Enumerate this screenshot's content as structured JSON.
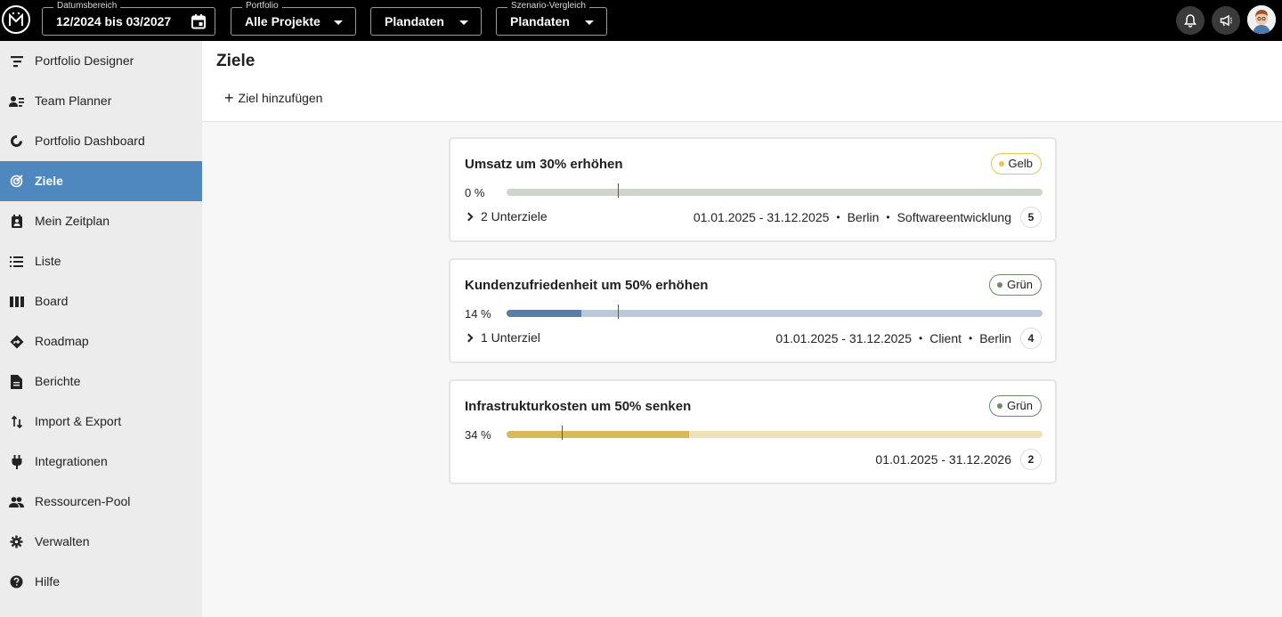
{
  "topbar": {
    "logo": "M",
    "date_range": {
      "label": "Datumsbereich",
      "value": "12/2024 bis 03/2027",
      "icon": "calendar-icon"
    },
    "portfolio": {
      "label": "Portfolio",
      "value": "Alle Projekte"
    },
    "data_select": {
      "value": "Plandaten"
    },
    "scenario": {
      "label": "Szenario-Vergleich",
      "value": "Plandaten"
    },
    "icons": [
      "bell-icon",
      "megaphone-icon",
      "avatar"
    ]
  },
  "sidebar": {
    "items": [
      {
        "label": "Portfolio Designer",
        "icon": "portfolio-designer-icon"
      },
      {
        "label": "Team Planner",
        "icon": "team-planner-icon"
      },
      {
        "label": "Portfolio Dashboard",
        "icon": "dashboard-icon"
      },
      {
        "label": "Ziele",
        "icon": "target-icon",
        "active": true
      },
      {
        "label": "Mein Zeitplan",
        "icon": "schedule-icon"
      },
      {
        "label": "Liste",
        "icon": "list-icon"
      },
      {
        "label": "Board",
        "icon": "board-icon"
      },
      {
        "label": "Roadmap",
        "icon": "roadmap-icon"
      },
      {
        "label": "Berichte",
        "icon": "report-icon"
      },
      {
        "label": "Import & Export",
        "icon": "import-export-icon"
      },
      {
        "label": "Integrationen",
        "icon": "plug-icon"
      },
      {
        "label": "Ressourcen-Pool",
        "icon": "people-icon"
      },
      {
        "label": "Verwalten",
        "icon": "gear-icon"
      },
      {
        "label": "Hilfe",
        "icon": "help-icon"
      }
    ],
    "active_color": "#4f87bf"
  },
  "main": {
    "title": "Ziele",
    "add_goal": "Ziel hinzufügen"
  },
  "goals": [
    {
      "title": "Umsatz um 30% erhöhen",
      "status": "Gelb",
      "status_color": "#e6c54a",
      "progress_label": "0 %",
      "progress": 0,
      "time_marker": 0.207,
      "bar_track_color": "#cfd6c9",
      "bar_fill_color": "#9aa894",
      "subgoals": "2 Unterziele",
      "date_range": "01.01.2025 - 31.12.2025",
      "tags": [
        "Berlin",
        "Softwareentwicklung"
      ],
      "count": "5"
    },
    {
      "title": "Kundenzufriedenheit um 50% erhöhen",
      "status": "Grün",
      "status_color": "#6f8a68",
      "progress_label": "14 %",
      "progress": 0.14,
      "time_marker": 0.207,
      "bar_track_color": "#bac8d8",
      "bar_fill_color": "#5b7ca3",
      "subgoals": "1 Unterziel",
      "date_range": "01.01.2025 - 31.12.2025",
      "tags": [
        "Client",
        "Berlin"
      ],
      "count": "4"
    },
    {
      "title": "Infrastrukturkosten um 50% senken",
      "status": "Grün",
      "status_color": "#6f8a68",
      "progress_label": "34 %",
      "progress": 0.34,
      "time_marker": 0.103,
      "bar_track_color": "#efe2b8",
      "bar_fill_color": "#d9b85a",
      "subgoals": "",
      "date_range": "01.01.2025 - 31.12.2026",
      "tags": [],
      "count": "2"
    }
  ]
}
